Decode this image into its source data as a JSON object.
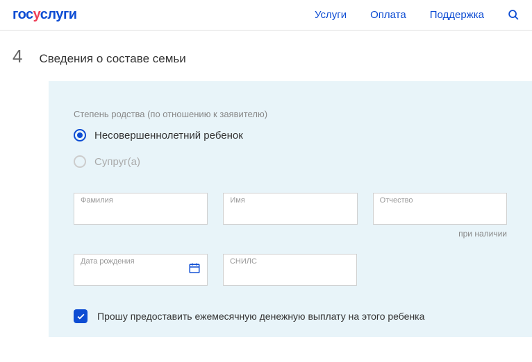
{
  "logo": {
    "part1": "гос",
    "part2": "у",
    "part3": "слуги"
  },
  "nav": {
    "services": "Услуги",
    "payment": "Оплата",
    "support": "Поддержка"
  },
  "step": {
    "number": "4",
    "title": "Сведения о составе семьи"
  },
  "relationship": {
    "label": "Степень родства (по отношению к заявителю)",
    "options": {
      "child": "Несовершеннолетний ребенок",
      "spouse": "Супруг(а)"
    }
  },
  "fields": {
    "lastname": {
      "label": "Фамилия"
    },
    "firstname": {
      "label": "Имя"
    },
    "patronymic": {
      "label": "Отчество",
      "hint": "при наличии"
    },
    "birthdate": {
      "label": "Дата рождения"
    },
    "snils": {
      "label": "СНИЛС"
    }
  },
  "checkbox": {
    "label": "Прошу предоставить ежемесячную денежную выплату на этого ребенка"
  }
}
